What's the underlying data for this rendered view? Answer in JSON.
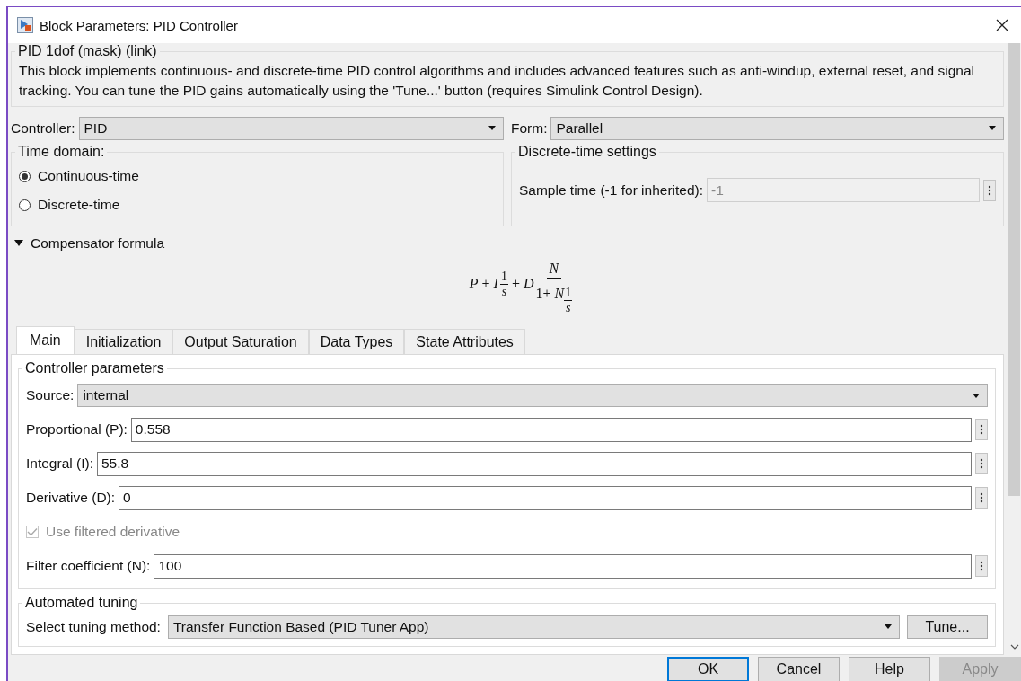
{
  "window": {
    "title": "Block Parameters: PID Controller"
  },
  "description": {
    "title": "PID 1dof (mask) (link)",
    "text": "This block implements continuous- and discrete-time PID control algorithms and includes advanced features such as anti-windup, external reset, and signal tracking. You can tune the PID gains automatically using the 'Tune...' button (requires Simulink Control Design)."
  },
  "controller": {
    "label": "Controller:",
    "value": "PID"
  },
  "form": {
    "label": "Form:",
    "value": "Parallel"
  },
  "time_domain": {
    "title": "Time domain:",
    "options": [
      {
        "label": "Continuous-time",
        "selected": true
      },
      {
        "label": "Discrete-time",
        "selected": false
      }
    ]
  },
  "discrete_settings": {
    "title": "Discrete-time settings",
    "sample_time": {
      "label": "Sample time (-1 for inherited):",
      "value": "-1",
      "disabled": true
    }
  },
  "compensator": {
    "title": "Compensator formula",
    "expanded": true,
    "formula": {
      "p": "P",
      "plus1": "+",
      "i": "I",
      "i_num": "1",
      "i_den": "s",
      "plus2": "+",
      "d": "D",
      "d_num": "N",
      "d_den_lead": "1+",
      "d_den_n": "N",
      "d_den_num": "1",
      "d_den_den": "s"
    }
  },
  "tabs": [
    {
      "label": "Main",
      "selected": true
    },
    {
      "label": "Initialization",
      "selected": false
    },
    {
      "label": "Output Saturation",
      "selected": false
    },
    {
      "label": "Data Types",
      "selected": false
    },
    {
      "label": "State Attributes",
      "selected": false
    }
  ],
  "controller_parameters": {
    "title": "Controller parameters",
    "source": {
      "label": "Source:",
      "value": "internal"
    },
    "params": [
      {
        "kind": "field",
        "label": "Proportional (P):",
        "value": "0.558"
      },
      {
        "kind": "field",
        "label": "Integral (I):",
        "value": "55.8"
      },
      {
        "kind": "field",
        "label": "Derivative (D):",
        "value": "0"
      },
      {
        "kind": "checkbox",
        "label": "Use filtered derivative",
        "checked": true,
        "disabled": true
      },
      {
        "kind": "field",
        "label": "Filter coefficient (N):",
        "value": "100"
      }
    ]
  },
  "automated_tuning": {
    "title": "Automated tuning",
    "method": {
      "label": "Select tuning method:",
      "value": "Transfer Function Based (PID Tuner App)"
    },
    "tune_button": "Tune..."
  },
  "buttons": [
    {
      "label": "OK",
      "focused": true,
      "disabled": false
    },
    {
      "label": "Cancel",
      "focused": false,
      "disabled": false
    },
    {
      "label": "Help",
      "focused": false,
      "disabled": false
    },
    {
      "label": "Apply",
      "focused": false,
      "disabled": true
    }
  ]
}
